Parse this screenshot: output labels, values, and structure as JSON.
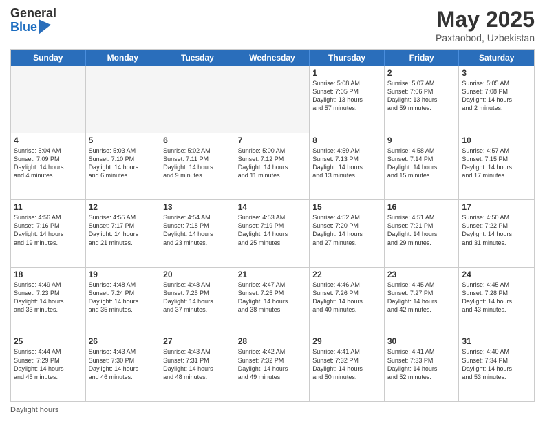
{
  "header": {
    "logo_general": "General",
    "logo_blue": "Blue",
    "month_title": "May 2025",
    "location": "Paxtaobod, Uzbekistan"
  },
  "days_of_week": [
    "Sunday",
    "Monday",
    "Tuesday",
    "Wednesday",
    "Thursday",
    "Friday",
    "Saturday"
  ],
  "footer": {
    "daylight_hours": "Daylight hours"
  },
  "rows": [
    [
      {
        "day": "",
        "info": "",
        "empty": true
      },
      {
        "day": "",
        "info": "",
        "empty": true
      },
      {
        "day": "",
        "info": "",
        "empty": true
      },
      {
        "day": "",
        "info": "",
        "empty": true
      },
      {
        "day": "1",
        "info": "Sunrise: 5:08 AM\nSunset: 7:05 PM\nDaylight: 13 hours\nand 57 minutes."
      },
      {
        "day": "2",
        "info": "Sunrise: 5:07 AM\nSunset: 7:06 PM\nDaylight: 13 hours\nand 59 minutes."
      },
      {
        "day": "3",
        "info": "Sunrise: 5:05 AM\nSunset: 7:08 PM\nDaylight: 14 hours\nand 2 minutes."
      }
    ],
    [
      {
        "day": "4",
        "info": "Sunrise: 5:04 AM\nSunset: 7:09 PM\nDaylight: 14 hours\nand 4 minutes."
      },
      {
        "day": "5",
        "info": "Sunrise: 5:03 AM\nSunset: 7:10 PM\nDaylight: 14 hours\nand 6 minutes."
      },
      {
        "day": "6",
        "info": "Sunrise: 5:02 AM\nSunset: 7:11 PM\nDaylight: 14 hours\nand 9 minutes."
      },
      {
        "day": "7",
        "info": "Sunrise: 5:00 AM\nSunset: 7:12 PM\nDaylight: 14 hours\nand 11 minutes."
      },
      {
        "day": "8",
        "info": "Sunrise: 4:59 AM\nSunset: 7:13 PM\nDaylight: 14 hours\nand 13 minutes."
      },
      {
        "day": "9",
        "info": "Sunrise: 4:58 AM\nSunset: 7:14 PM\nDaylight: 14 hours\nand 15 minutes."
      },
      {
        "day": "10",
        "info": "Sunrise: 4:57 AM\nSunset: 7:15 PM\nDaylight: 14 hours\nand 17 minutes."
      }
    ],
    [
      {
        "day": "11",
        "info": "Sunrise: 4:56 AM\nSunset: 7:16 PM\nDaylight: 14 hours\nand 19 minutes."
      },
      {
        "day": "12",
        "info": "Sunrise: 4:55 AM\nSunset: 7:17 PM\nDaylight: 14 hours\nand 21 minutes."
      },
      {
        "day": "13",
        "info": "Sunrise: 4:54 AM\nSunset: 7:18 PM\nDaylight: 14 hours\nand 23 minutes."
      },
      {
        "day": "14",
        "info": "Sunrise: 4:53 AM\nSunset: 7:19 PM\nDaylight: 14 hours\nand 25 minutes."
      },
      {
        "day": "15",
        "info": "Sunrise: 4:52 AM\nSunset: 7:20 PM\nDaylight: 14 hours\nand 27 minutes."
      },
      {
        "day": "16",
        "info": "Sunrise: 4:51 AM\nSunset: 7:21 PM\nDaylight: 14 hours\nand 29 minutes."
      },
      {
        "day": "17",
        "info": "Sunrise: 4:50 AM\nSunset: 7:22 PM\nDaylight: 14 hours\nand 31 minutes."
      }
    ],
    [
      {
        "day": "18",
        "info": "Sunrise: 4:49 AM\nSunset: 7:23 PM\nDaylight: 14 hours\nand 33 minutes."
      },
      {
        "day": "19",
        "info": "Sunrise: 4:48 AM\nSunset: 7:24 PM\nDaylight: 14 hours\nand 35 minutes."
      },
      {
        "day": "20",
        "info": "Sunrise: 4:48 AM\nSunset: 7:25 PM\nDaylight: 14 hours\nand 37 minutes."
      },
      {
        "day": "21",
        "info": "Sunrise: 4:47 AM\nSunset: 7:25 PM\nDaylight: 14 hours\nand 38 minutes."
      },
      {
        "day": "22",
        "info": "Sunrise: 4:46 AM\nSunset: 7:26 PM\nDaylight: 14 hours\nand 40 minutes."
      },
      {
        "day": "23",
        "info": "Sunrise: 4:45 AM\nSunset: 7:27 PM\nDaylight: 14 hours\nand 42 minutes."
      },
      {
        "day": "24",
        "info": "Sunrise: 4:45 AM\nSunset: 7:28 PM\nDaylight: 14 hours\nand 43 minutes."
      }
    ],
    [
      {
        "day": "25",
        "info": "Sunrise: 4:44 AM\nSunset: 7:29 PM\nDaylight: 14 hours\nand 45 minutes."
      },
      {
        "day": "26",
        "info": "Sunrise: 4:43 AM\nSunset: 7:30 PM\nDaylight: 14 hours\nand 46 minutes."
      },
      {
        "day": "27",
        "info": "Sunrise: 4:43 AM\nSunset: 7:31 PM\nDaylight: 14 hours\nand 48 minutes."
      },
      {
        "day": "28",
        "info": "Sunrise: 4:42 AM\nSunset: 7:32 PM\nDaylight: 14 hours\nand 49 minutes."
      },
      {
        "day": "29",
        "info": "Sunrise: 4:41 AM\nSunset: 7:32 PM\nDaylight: 14 hours\nand 50 minutes."
      },
      {
        "day": "30",
        "info": "Sunrise: 4:41 AM\nSunset: 7:33 PM\nDaylight: 14 hours\nand 52 minutes."
      },
      {
        "day": "31",
        "info": "Sunrise: 4:40 AM\nSunset: 7:34 PM\nDaylight: 14 hours\nand 53 minutes."
      }
    ]
  ]
}
